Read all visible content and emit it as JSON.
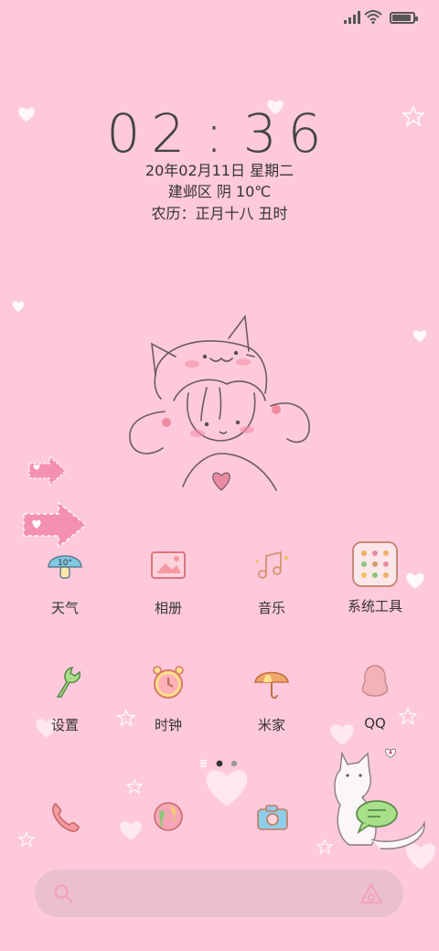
{
  "status_bar": {
    "signal": "signal-icon",
    "wifi": "wifi-icon",
    "battery_level": 0.9
  },
  "clock": {
    "hour": "02",
    "minute": "36",
    "separator": ":"
  },
  "date": "20年02月11日 星期二",
  "weather": "建邺区  阴  10℃",
  "lunar": "农历：正月十八 丑时",
  "apps": [
    {
      "label": "天气",
      "icon": "weather-mushroom-icon",
      "badge": "10°"
    },
    {
      "label": "相册",
      "icon": "gallery-icon"
    },
    {
      "label": "音乐",
      "icon": "music-icon"
    },
    {
      "label": "系统工具",
      "icon": "system-tools-folder-icon"
    },
    {
      "label": "设置",
      "icon": "settings-wrench-icon"
    },
    {
      "label": "时钟",
      "icon": "alarm-clock-icon"
    },
    {
      "label": "米家",
      "icon": "umbrella-icon"
    },
    {
      "label": "QQ",
      "icon": "qq-penguin-icon"
    }
  ],
  "page_indicator": {
    "pages": 2,
    "current": 1
  },
  "dock": [
    "phone-icon",
    "browser-icon",
    "camera-icon",
    "messages-cat-icon"
  ],
  "search": {
    "search_icon": "search-icon",
    "assistant_icon": "assistant-icon"
  },
  "colors": {
    "background": "#ffc9dc",
    "search_bar": "#e6becd",
    "accent_pink": "#f4a3bd"
  }
}
